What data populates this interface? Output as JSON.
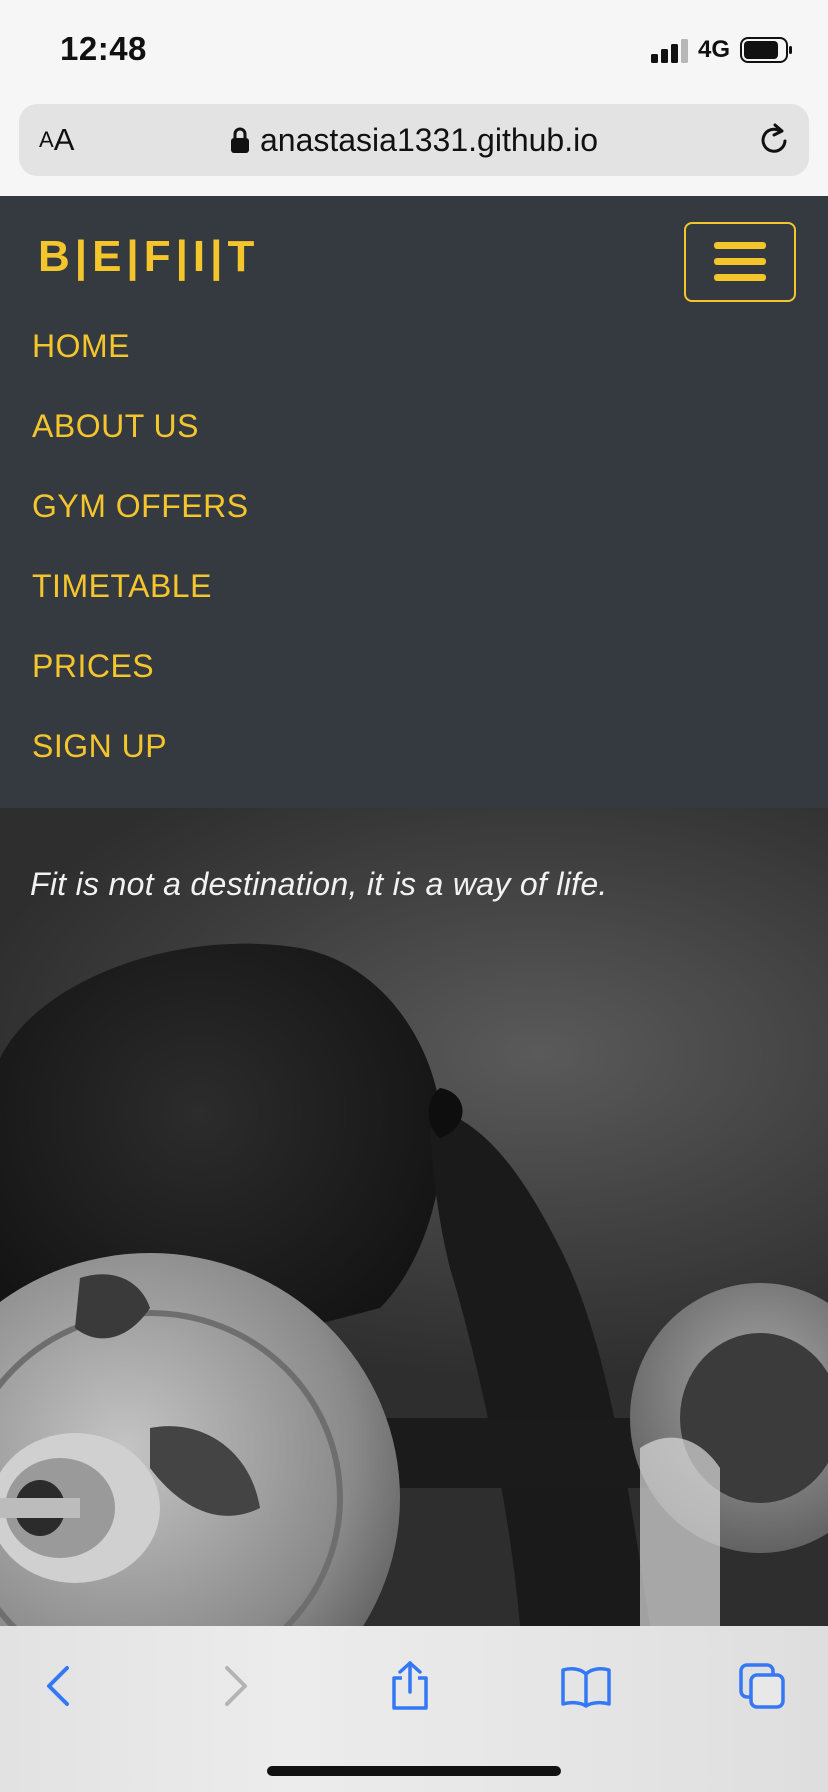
{
  "status_bar": {
    "time": "12:48",
    "network": "4G",
    "icons": [
      "signal-icon",
      "battery-icon"
    ]
  },
  "browser": {
    "aa_small": "A",
    "aa_large": "A",
    "url": "anastasia1331.github.io",
    "icons": [
      "lock-icon",
      "reload-icon"
    ]
  },
  "site": {
    "logo": "B|E|F|I|T",
    "accent_color": "#f5c52c",
    "navbar_color": "#343a40",
    "menu_icon": "hamburger-menu-icon",
    "nav_items": [
      {
        "label": "HOME"
      },
      {
        "label": "ABOUT US"
      },
      {
        "label": "GYM OFFERS"
      },
      {
        "label": "TIMETABLE"
      },
      {
        "label": "PRICES"
      },
      {
        "label": "SIGN UP"
      }
    ]
  },
  "hero": {
    "quote": "Fit is not a destination, it is a way of life."
  },
  "toolbar": {
    "icons": [
      "back-icon",
      "forward-icon",
      "share-icon",
      "bookmarks-icon",
      "tabs-icon"
    ],
    "accent_color": "#3478f6"
  }
}
